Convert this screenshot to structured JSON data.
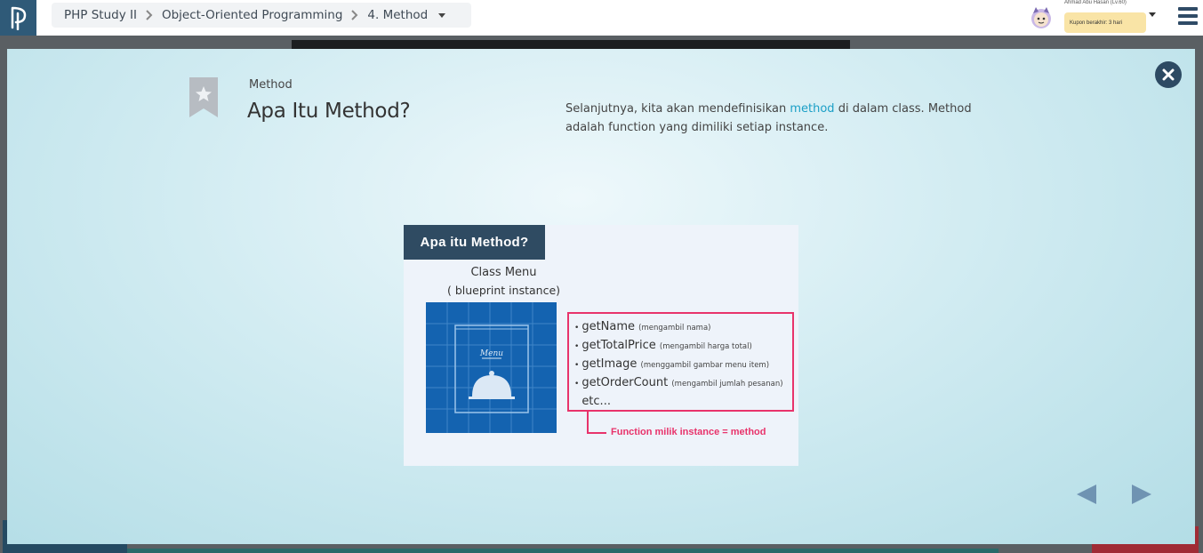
{
  "header": {
    "breadcrumb": [
      "PHP Study II",
      "Object-Oriented Programming",
      "4. Method"
    ],
    "user_name": "Ahmad Abu Hasan (Lv.60)",
    "coupon": "Kupon berakhir: 3 hari"
  },
  "slide": {
    "eyebrow": "Method",
    "title": "Apa Itu Method?",
    "description_before": "Selanjutnya, kita akan mendefinisikan ",
    "description_link": "method",
    "description_after": " di dalam class. Method adalah function yang dimiliki setiap instance."
  },
  "figure": {
    "header": "Apa itu Method?",
    "class_name": "Class Menu",
    "class_sub": "( blueprint instance)",
    "card_label": "Menu",
    "methods": [
      {
        "name": "getName",
        "note": "(mengambil nama)"
      },
      {
        "name": "getTotalPrice",
        "note": "(mengambil harga total)"
      },
      {
        "name": "getImage",
        "note": "(menggambil gambar menu item)"
      },
      {
        "name": "getOrderCount",
        "note": "(mengambil jumlah pesanan)"
      },
      {
        "name": "etc...",
        "note": ""
      }
    ],
    "caption": "Function milik instance = method"
  },
  "colors": {
    "accent": "#1a9fc6",
    "highlight": "#e8336b",
    "header_dark": "#2f4b62"
  }
}
